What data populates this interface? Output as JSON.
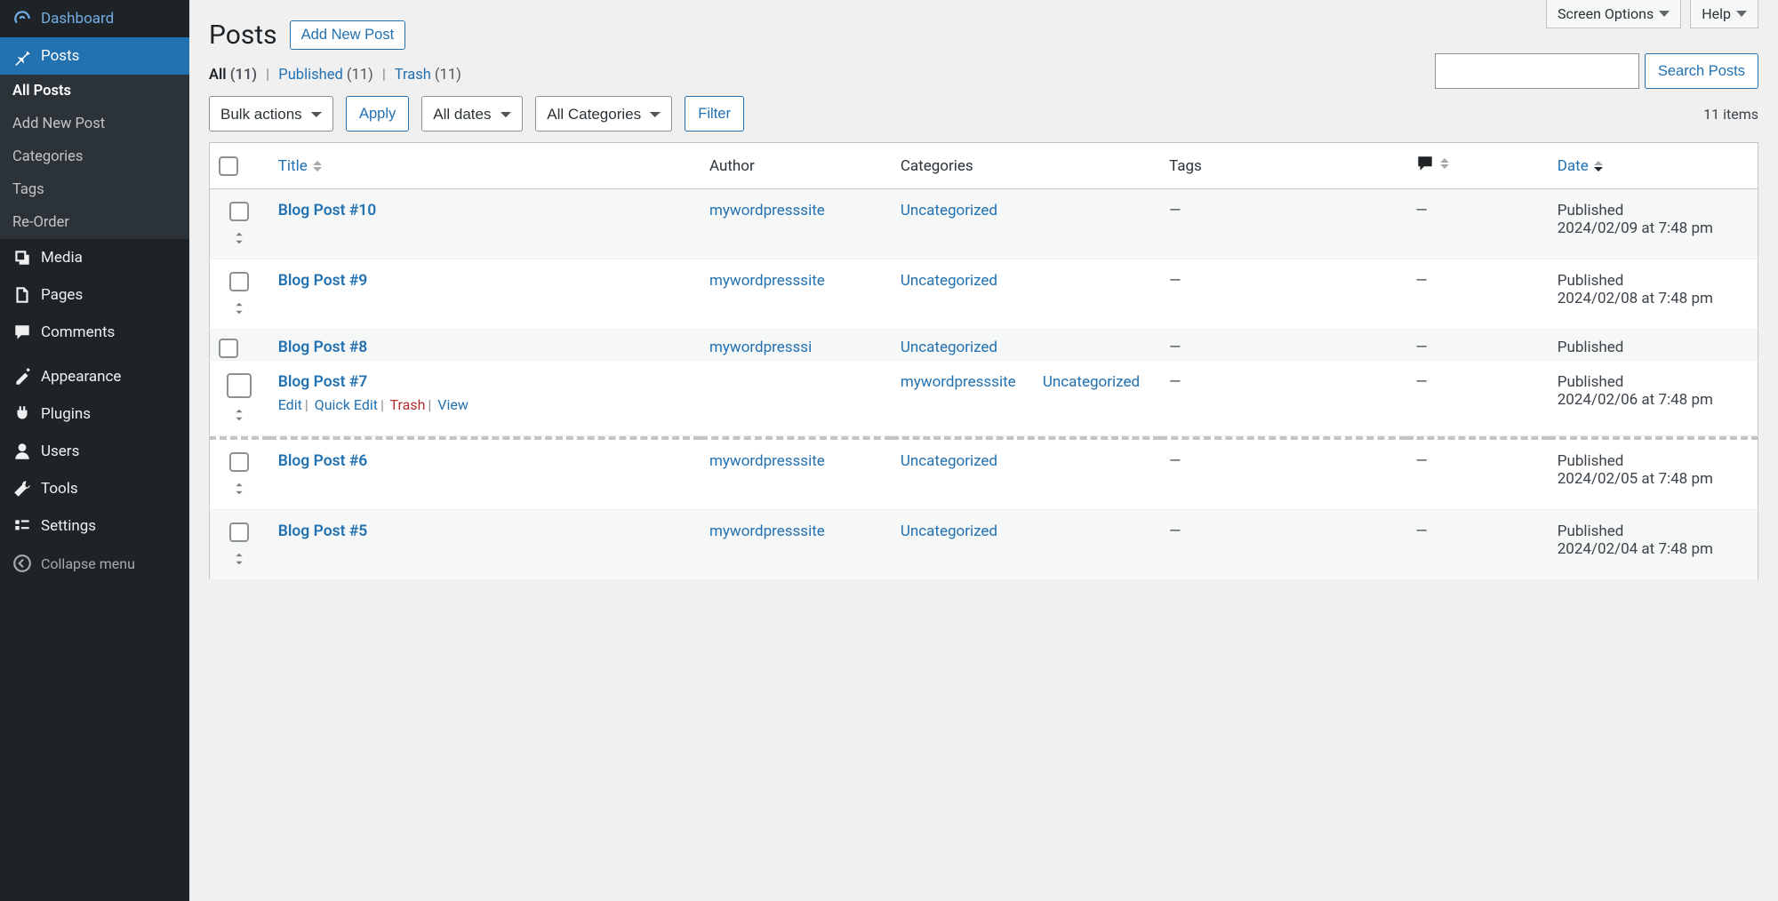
{
  "top_tabs": {
    "screen_options": "Screen Options",
    "help": "Help"
  },
  "sidebar": {
    "dashboard": "Dashboard",
    "posts": "Posts",
    "submenu": {
      "all_posts": "All Posts",
      "add_new": "Add New Post",
      "categories": "Categories",
      "tags": "Tags",
      "reorder": "Re-Order"
    },
    "media": "Media",
    "pages": "Pages",
    "comments": "Comments",
    "appearance": "Appearance",
    "plugins": "Plugins",
    "users": "Users",
    "tools": "Tools",
    "settings": "Settings",
    "collapse": "Collapse menu"
  },
  "header": {
    "title": "Posts",
    "add_new": "Add New Post"
  },
  "filters": {
    "all_label": "All",
    "all_count": "(11)",
    "published_label": "Published",
    "published_count": "(11)",
    "trash_label": "Trash",
    "trash_count": "(11)"
  },
  "search": {
    "button": "Search Posts"
  },
  "toolbar": {
    "bulk_actions": "Bulk actions",
    "apply": "Apply",
    "all_dates": "All dates",
    "all_categories": "All Categories",
    "filter": "Filter",
    "item_count": "11 items"
  },
  "columns": {
    "title": "Title",
    "author": "Author",
    "categories": "Categories",
    "tags": "Tags",
    "date": "Date"
  },
  "row_actions": {
    "edit": "Edit",
    "quick_edit": "Quick Edit",
    "trash": "Trash",
    "view": "View"
  },
  "dash": "—",
  "posts": [
    {
      "title": "Blog Post #10",
      "author": "mywordpresssite",
      "category": "Uncategorized",
      "status": "Published",
      "date": "2024/02/09 at 7:48 pm"
    },
    {
      "title": "Blog Post #9",
      "author": "mywordpresssite",
      "category": "Uncategorized",
      "status": "Published",
      "date": "2024/02/08 at 7:48 pm"
    },
    {
      "title": "Blog Post #8",
      "author": "mywordpresssi",
      "category": "Uncategorized",
      "status": "Published",
      "date": ""
    },
    {
      "title": "Blog Post #7",
      "author": "mywordpresssite",
      "category": "Uncategorized",
      "status": "Published",
      "date": "2024/02/06 at 7:48 pm"
    },
    {
      "title": "Blog Post #6",
      "author": "mywordpresssite",
      "category": "Uncategorized",
      "status": "Published",
      "date": "2024/02/05 at 7:48 pm"
    },
    {
      "title": "Blog Post #5",
      "author": "mywordpresssite",
      "category": "Uncategorized",
      "status": "Published",
      "date": "2024/02/04 at 7:48 pm"
    }
  ]
}
